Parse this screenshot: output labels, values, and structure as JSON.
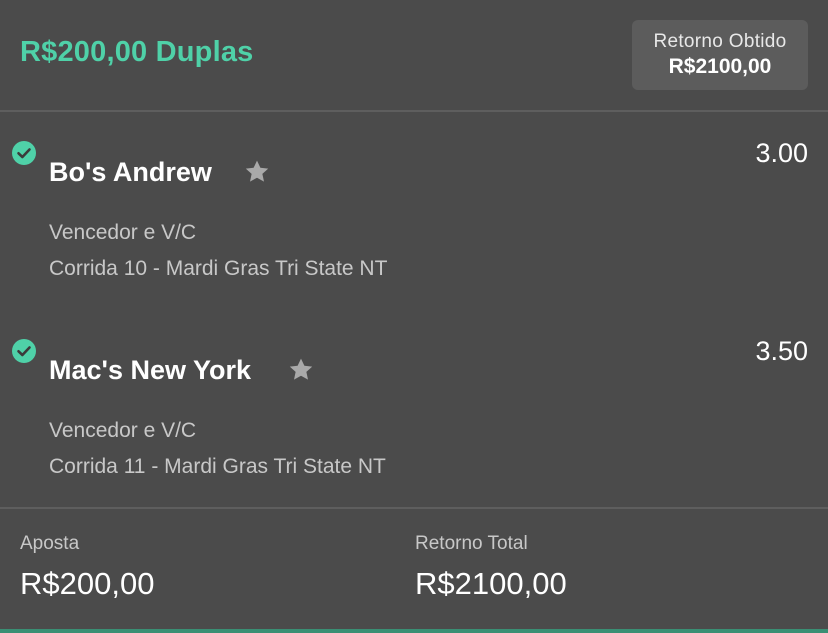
{
  "header": {
    "bet_title": "R$200,00 Duplas",
    "return_label": "Retorno Obtido",
    "return_value": "R$2100,00",
    "accent_color": "#4fd1a8"
  },
  "selections": [
    {
      "status_icon": "check-circle-icon",
      "runner": "Bo's Andrew",
      "favorite_icon": "star-icon",
      "odds": "3.00",
      "market": "Vencedor e V/C",
      "race": "Corrida 10 - Mardi Gras Tri State NT"
    },
    {
      "status_icon": "check-circle-icon",
      "runner": "Mac's New York",
      "favorite_icon": "star-icon",
      "odds": "3.50",
      "market": "Vencedor e V/C",
      "race": "Corrida 11 - Mardi Gras Tri State NT"
    }
  ],
  "footer": {
    "stake_label": "Aposta",
    "stake_value": "R$200,00",
    "total_return_label": "Retorno Total",
    "total_return_value": "R$2100,00"
  }
}
